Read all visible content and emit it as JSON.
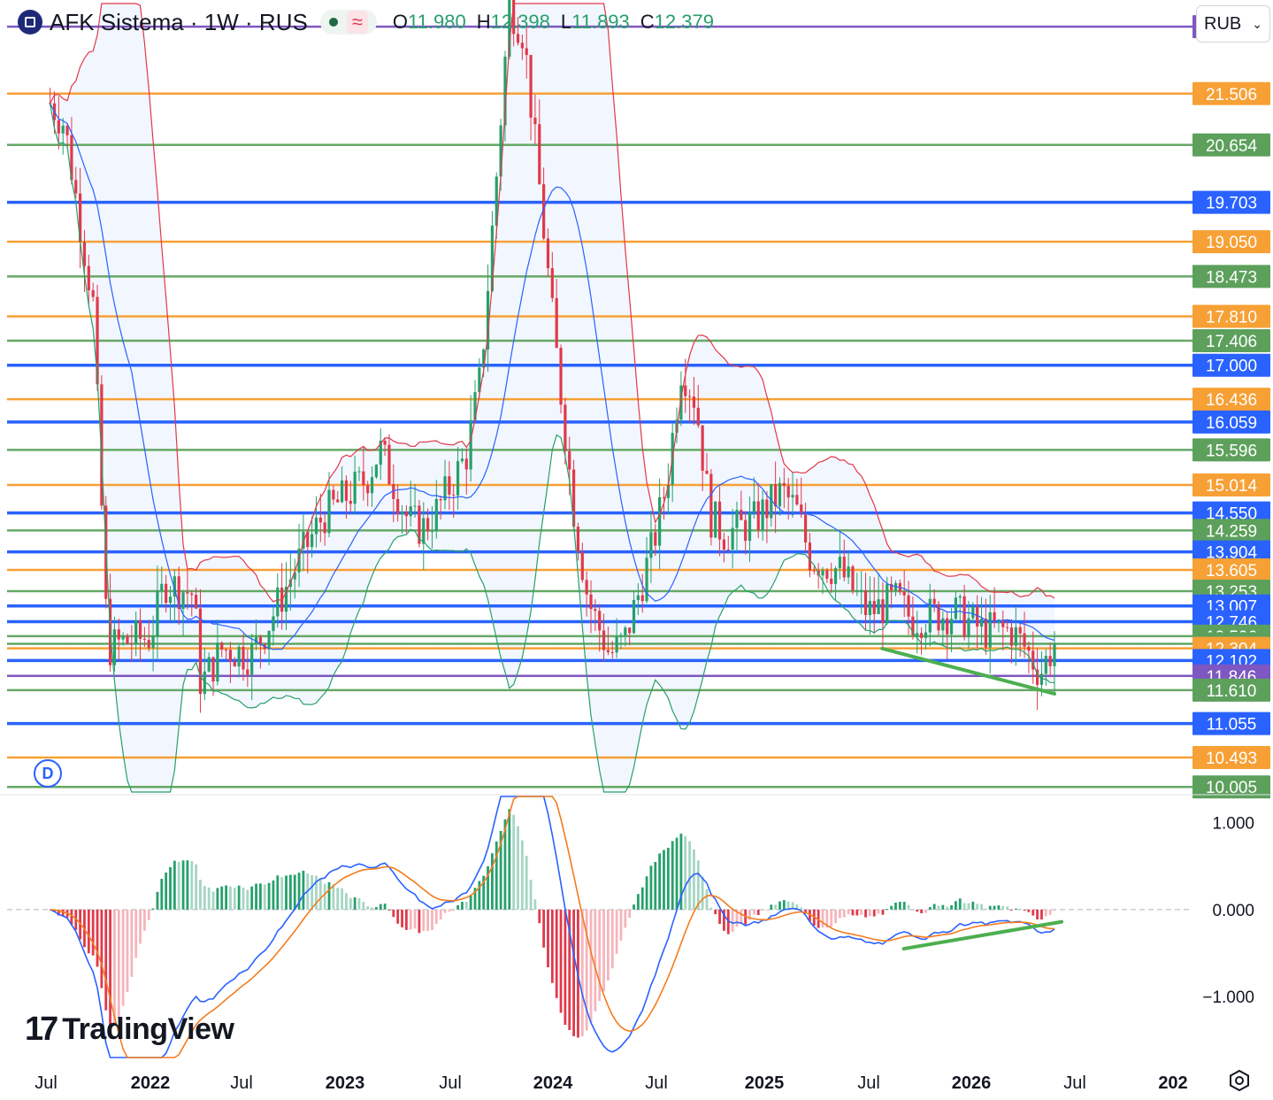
{
  "header": {
    "symbol_title": "AFK Sistema · 1W · RUS",
    "ohlc": [
      {
        "k": "O",
        "v": "11.980"
      },
      {
        "k": "H",
        "v": "12.398"
      },
      {
        "k": "L",
        "v": "11.893"
      },
      {
        "k": "C",
        "v": "12.379"
      }
    ],
    "currency": "RUB",
    "wave_icon": "wave-icon"
  },
  "watermark": {
    "mark": "17",
    "text": "TradingView"
  },
  "badge": "D",
  "chart_data": [
    {
      "type": "candlestick",
      "title": "AFK Sistema · 1W · RUS",
      "y_axis_side": "right",
      "ylim": [
        9.92,
        23.0
      ],
      "x_axis_labels": [
        "Jul",
        "2022",
        "Jul",
        "2023",
        "Jul",
        "2024",
        "Jul",
        "2025",
        "Jul",
        "2026",
        "Jul",
        "202"
      ],
      "price_levels": [
        {
          "value": 22.617,
          "color": "#7e57c2"
        },
        {
          "value": 21.506,
          "color": "#f7a035"
        },
        {
          "value": 20.654,
          "color": "#66a865"
        },
        {
          "value": 19.703,
          "color": "#2962ff"
        },
        {
          "value": 19.05,
          "color": "#f7a035"
        },
        {
          "value": 18.473,
          "color": "#66a865"
        },
        {
          "value": 17.81,
          "color": "#f7a035"
        },
        {
          "value": 17.406,
          "color": "#66a865"
        },
        {
          "value": 17.0,
          "color": "#2962ff"
        },
        {
          "value": 16.436,
          "color": "#f7a035"
        },
        {
          "value": 16.059,
          "color": "#2962ff"
        },
        {
          "value": 15.596,
          "color": "#66a865"
        },
        {
          "value": 15.014,
          "color": "#f7a035"
        },
        {
          "value": 14.55,
          "color": "#2962ff"
        },
        {
          "value": 14.259,
          "color": "#66a865"
        },
        {
          "value": 13.904,
          "color": "#2962ff"
        },
        {
          "value": 13.605,
          "color": "#f7a035"
        },
        {
          "value": 13.253,
          "color": "#66a865"
        },
        {
          "value": 13.007,
          "color": "#2962ff"
        },
        {
          "value": 12.746,
          "color": "#2962ff"
        },
        {
          "value": 12.506,
          "color": "#66a865"
        },
        {
          "value": 12.379,
          "color": "#66a865"
        },
        {
          "value": 12.304,
          "color": "#f7a035"
        },
        {
          "value": 12.102,
          "color": "#2962ff"
        },
        {
          "value": 11.846,
          "color": "#7e57c2"
        },
        {
          "value": 11.61,
          "color": "#66a865"
        },
        {
          "value": 11.055,
          "color": "#2962ff"
        },
        {
          "value": 10.493,
          "color": "#f7a035"
        },
        {
          "value": 10.005,
          "color": "#66a865"
        }
      ],
      "close_path": [
        [
          0.0,
          22.4
        ],
        [
          0.04,
          21.0
        ],
        [
          0.06,
          18.0
        ],
        [
          0.07,
          12.3
        ],
        [
          0.08,
          12.4
        ],
        [
          0.1,
          12.5
        ],
        [
          0.11,
          13.4
        ],
        [
          0.13,
          13.2
        ],
        [
          0.135,
          11.7
        ],
        [
          0.15,
          12.3
        ],
        [
          0.17,
          12.2
        ],
        [
          0.18,
          12.6
        ],
        [
          0.2,
          13.6
        ],
        [
          0.22,
          14.5
        ],
        [
          0.25,
          15.1
        ],
        [
          0.26,
          15.6
        ],
        [
          0.27,
          15.0
        ],
        [
          0.28,
          14.4
        ],
        [
          0.29,
          14.3
        ],
        [
          0.3,
          14.6
        ],
        [
          0.32,
          15.5
        ],
        [
          0.33,
          16.8
        ],
        [
          0.34,
          19.8
        ],
        [
          0.35,
          23.0
        ],
        [
          0.36,
          22.5
        ],
        [
          0.37,
          20.2
        ],
        [
          0.38,
          17.8
        ],
        [
          0.395,
          14.6
        ],
        [
          0.405,
          13.1
        ],
        [
          0.42,
          12.2
        ],
        [
          0.43,
          12.4
        ],
        [
          0.44,
          13.2
        ],
        [
          0.45,
          14.0
        ],
        [
          0.46,
          15.1
        ],
        [
          0.47,
          17.0
        ],
        [
          0.48,
          16.4
        ],
        [
          0.49,
          14.5
        ],
        [
          0.5,
          14.2
        ],
        [
          0.52,
          14.4
        ],
        [
          0.54,
          14.9
        ],
        [
          0.55,
          14.6
        ],
        [
          0.56,
          13.8
        ],
        [
          0.58,
          13.6
        ],
        [
          0.6,
          12.9
        ],
        [
          0.62,
          13.1
        ],
        [
          0.63,
          12.8
        ],
        [
          0.66,
          12.9
        ],
        [
          0.68,
          12.6
        ],
        [
          0.7,
          12.6
        ],
        [
          0.71,
          12.3
        ],
        [
          0.72,
          11.9
        ],
        [
          0.73,
          12.38
        ]
      ],
      "bollinger": "upper red, middle blue, lower green",
      "trendline": {
        "from": [
          0.61,
          12.3
        ],
        "to": [
          0.73,
          11.55
        ],
        "color": "#4caf50"
      }
    },
    {
      "type": "macd",
      "y_axis_labels": [
        "1.000",
        "0.000",
        "−1.000"
      ],
      "ylim": [
        -1.7,
        1.3
      ],
      "trendline": {
        "from": [
          0.625,
          -0.45
        ],
        "to": [
          0.735,
          -0.14
        ],
        "color": "#4caf50"
      }
    }
  ]
}
